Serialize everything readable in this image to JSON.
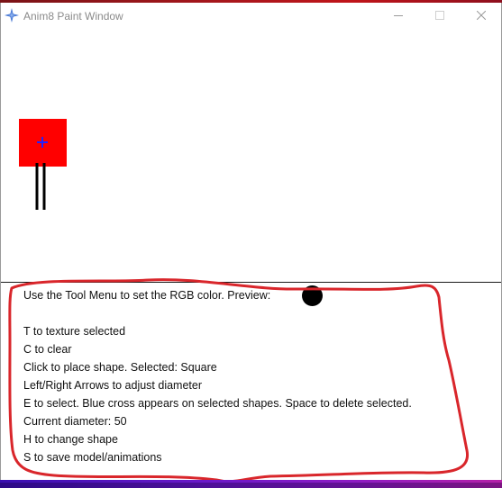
{
  "window": {
    "title": "Anim8 Paint Window",
    "controls": {
      "minimize_icon": "minimize-icon",
      "maximize_icon": "maximize-icon",
      "close_icon": "close-icon"
    }
  },
  "canvas": {
    "selected_shape": {
      "type": "Square",
      "fill_color": "#ff0000",
      "selection_marker_color": "#2222ff",
      "selected": true
    },
    "line_shapes": [
      {
        "color": "#000000"
      },
      {
        "color": "#000000"
      }
    ]
  },
  "panel": {
    "preview": {
      "text": "Use the Tool Menu to set the RGB color. Preview:",
      "color": "#000000"
    },
    "lines": [
      "T to texture selected",
      "C to clear",
      "Click to place shape. Selected: Square",
      "Left/Right Arrows to adjust diameter",
      "E to select. Blue cross appears on selected shapes. Space to delete selected.",
      "Current diameter: 50",
      "H to change shape",
      "S to save model/animations"
    ]
  },
  "annotation": {
    "color": "#d9262b"
  }
}
